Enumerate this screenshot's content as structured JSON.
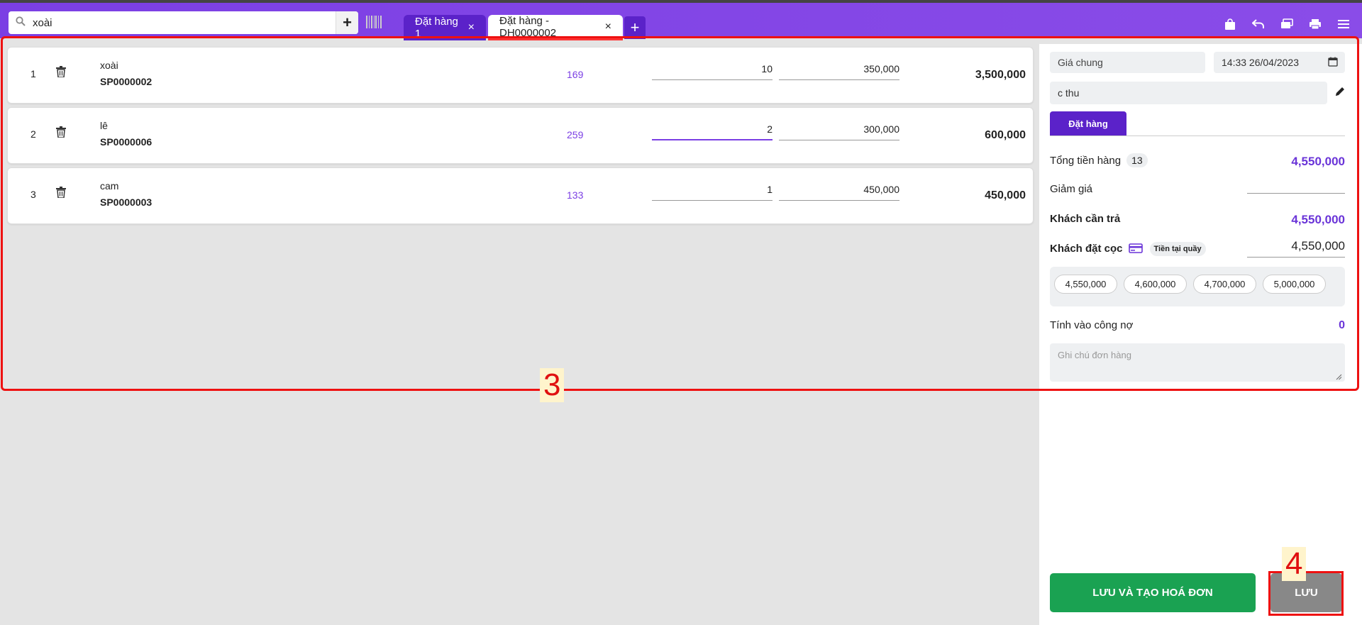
{
  "search": {
    "value": "xoài"
  },
  "tabs": [
    {
      "label": "Đặt hàng 1"
    },
    {
      "label": "Đặt hàng - DH0000002"
    }
  ],
  "items": [
    {
      "index": "1",
      "name": "xoài",
      "code": "SP0000002",
      "stock": "169",
      "qty": "10",
      "price": "350,000",
      "total": "3,500,000"
    },
    {
      "index": "2",
      "name": "lê",
      "code": "SP0000006",
      "stock": "259",
      "qty": "2",
      "price": "300,000",
      "total": "600,000"
    },
    {
      "index": "3",
      "name": "cam",
      "code": "SP0000003",
      "stock": "133",
      "qty": "1",
      "price": "450,000",
      "total": "450,000"
    }
  ],
  "panel": {
    "price_list": "Giá chung",
    "datetime": "14:33 26/04/2023",
    "customer": "c thu",
    "tab_label": "Đặt hàng",
    "subtotal_label": "Tổng tiền hàng",
    "subtotal_count": "13",
    "subtotal_value": "4,550,000",
    "discount_label": "Giảm giá",
    "to_pay_label": "Khách cần trả",
    "to_pay_value": "4,550,000",
    "deposit_label": "Khách đặt cọc",
    "deposit_method": "Tiền tại quầy",
    "deposit_value": "4,550,000",
    "quick_amounts": [
      "4,550,000",
      "4,600,000",
      "4,700,000",
      "5,000,000"
    ],
    "debt_label": "Tính vào công nợ",
    "debt_value": "0",
    "note_placeholder": "Ghi chú đơn hàng",
    "save_invoice_label": "LƯU VÀ TẠO HOÁ ĐƠN",
    "save_label": "LƯU"
  },
  "annotations": {
    "box3": "3",
    "box4": "4"
  },
  "colors": {
    "accent": "#7b3fe4",
    "tab_active": "#5b22c9",
    "green": "#1aa252",
    "annotation": "#ee1111"
  }
}
